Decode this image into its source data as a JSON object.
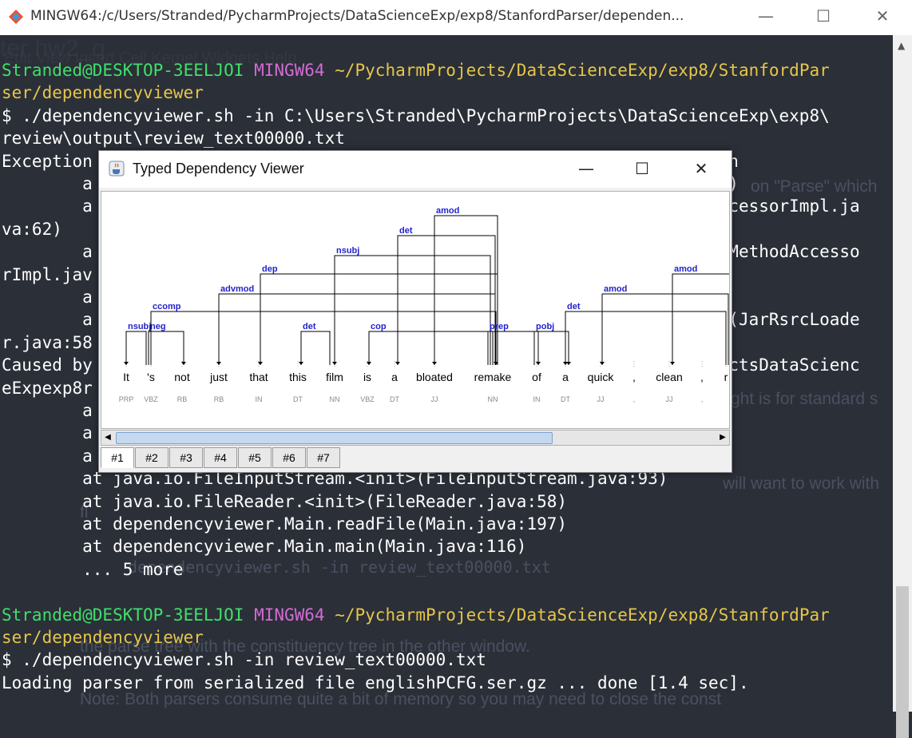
{
  "window": {
    "title": "MINGW64:/c/Users/Stranded/PycharmProjects/DataScienceExp/exp8/StanfordParser/dependen...",
    "minimize": "—",
    "maximize": "☐",
    "close": "✕"
  },
  "terminal": {
    "lines": [
      {
        "parts": [
          {
            "t": "Stranded@DESKTOP-3EELJOI ",
            "c": "g"
          },
          {
            "t": "MINGW64 ",
            "c": "m"
          },
          {
            "t": "~/PycharmProjects/DataScienceExp/exp8/StanfordPar",
            "c": "y"
          }
        ]
      },
      {
        "parts": [
          {
            "t": "ser/dependencyviewer",
            "c": "y"
          }
        ]
      },
      {
        "parts": [
          {
            "t": "$ ./dependencyviewer.sh -in C:\\Users\\Stranded\\PycharmProjects\\DataScienceExp\\exp8\\",
            "c": ""
          }
        ]
      },
      {
        "parts": [
          {
            "t": "review\\output\\review_text00000.txt",
            "c": ""
          }
        ]
      },
      {
        "parts": [
          {
            "t": "Exception                                                             ion",
            "c": ""
          }
        ]
      },
      {
        "parts": [
          {
            "t": "        a                                                             od)",
            "c": ""
          }
        ]
      },
      {
        "parts": [
          {
            "t": "        a                                                             AccessorImpl.ja",
            "c": ""
          }
        ]
      },
      {
        "parts": [
          {
            "t": "va:62)",
            "c": ""
          }
        ]
      },
      {
        "parts": [
          {
            "t": "        a                                                             ngMethodAccesso",
            "c": ""
          }
        ]
      },
      {
        "parts": [
          {
            "t": "rImpl.jav",
            "c": ""
          }
        ]
      },
      {
        "parts": [
          {
            "t": "        a",
            "c": ""
          }
        ]
      },
      {
        "parts": [
          {
            "t": "        a                                                             in(JarRsrcLoade",
            "c": ""
          }
        ]
      },
      {
        "parts": [
          {
            "t": "r.java:58",
            "c": ""
          }
        ]
      },
      {
        "parts": [
          {
            "t": "Caused by                                                             jectsDataScienc",
            "c": ""
          }
        ]
      },
      {
        "parts": [
          {
            "t": "eExpexp8r",
            "c": ""
          }
        ]
      },
      {
        "parts": [
          {
            "t": "        a",
            "c": ""
          }
        ]
      },
      {
        "parts": [
          {
            "t": "        a",
            "c": ""
          }
        ]
      },
      {
        "parts": [
          {
            "t": "        a",
            "c": ""
          }
        ]
      },
      {
        "parts": [
          {
            "t": "        at java.io.FileInputStream.<init>(FileInputStream.java:93)",
            "c": ""
          }
        ]
      },
      {
        "parts": [
          {
            "t": "        at java.io.FileReader.<init>(FileReader.java:58)",
            "c": ""
          }
        ]
      },
      {
        "parts": [
          {
            "t": "        at dependencyviewer.Main.readFile(Main.java:197)",
            "c": ""
          }
        ]
      },
      {
        "parts": [
          {
            "t": "        at dependencyviewer.Main.main(Main.java:116)",
            "c": ""
          }
        ]
      },
      {
        "parts": [
          {
            "t": "        ... 5 more",
            "c": ""
          }
        ]
      },
      {
        "parts": [
          {
            "t": "",
            "c": ""
          }
        ]
      },
      {
        "parts": [
          {
            "t": "Stranded@DESKTOP-3EELJOI ",
            "c": "g"
          },
          {
            "t": "MINGW64 ",
            "c": "m"
          },
          {
            "t": "~/PycharmProjects/DataScienceExp/exp8/StanfordPar",
            "c": "y"
          }
        ]
      },
      {
        "parts": [
          {
            "t": "ser/dependencyviewer",
            "c": "y"
          }
        ]
      },
      {
        "parts": [
          {
            "t": "$ ./dependencyviewer.sh -in review_text00000.txt",
            "c": ""
          }
        ]
      },
      {
        "parts": [
          {
            "t": "Loading parser from serialized file englishPCFG.ser.gz ... done [1.4 sec].",
            "c": ""
          }
        ]
      }
    ]
  },
  "background_ghost": {
    "items": [
      "Edit    View    Insert    Cell    Kernel    Widgets    Help",
      "on \"Parse\" which",
      "ght is for standard s",
      "will want to work with",
      "fi",
      "dependencyviewer.sh -in review_text00000.txt",
      "the parse tree with the constituency tree in the other window.",
      "Note: Both parsers consume quite a bit of memory so you may need to close the const",
      "ter  hw2_q"
    ]
  },
  "viewer": {
    "title": "Typed Dependency Viewer",
    "minimize": "—",
    "maximize": "☐",
    "close": "✕",
    "tabs": [
      "#1",
      "#2",
      "#3",
      "#4",
      "#5",
      "#6",
      "#7"
    ],
    "selected_tab": "#1",
    "words": [
      {
        "w": "It",
        "pos": "PRP"
      },
      {
        "w": "'s",
        "pos": "VBZ"
      },
      {
        "w": "not",
        "pos": "RB"
      },
      {
        "w": "just",
        "pos": "RB"
      },
      {
        "w": "that",
        "pos": "IN"
      },
      {
        "w": "this",
        "pos": "DT"
      },
      {
        "w": "film",
        "pos": "NN"
      },
      {
        "w": "is",
        "pos": "VBZ"
      },
      {
        "w": "a",
        "pos": "DT"
      },
      {
        "w": "bloated",
        "pos": "JJ"
      },
      {
        "w": "remake",
        "pos": "NN"
      },
      {
        "w": "of",
        "pos": "IN"
      },
      {
        "w": "a",
        "pos": "DT"
      },
      {
        "w": "quick",
        "pos": "JJ"
      },
      {
        "w": ",",
        "pos": ","
      },
      {
        "w": "clean",
        "pos": "JJ"
      },
      {
        "w": ",",
        "pos": ","
      },
      {
        "w": "r",
        "pos": ""
      }
    ],
    "arcs": [
      {
        "label": "nsubj",
        "from": 1,
        "to": 0
      },
      {
        "label": "neg",
        "from": 1,
        "to": 2
      },
      {
        "label": "ccomp",
        "from": 1,
        "to": 10
      },
      {
        "label": "advmod",
        "from": 10,
        "to": 3
      },
      {
        "label": "dep",
        "from": 10,
        "to": 4
      },
      {
        "label": "det",
        "from": 6,
        "to": 5
      },
      {
        "label": "nsubj",
        "from": 10,
        "to": 6
      },
      {
        "label": "cop",
        "from": 10,
        "to": 7
      },
      {
        "label": "det",
        "from": 10,
        "to": 8
      },
      {
        "label": "amod",
        "from": 10,
        "to": 9
      },
      {
        "label": "prep",
        "from": 10,
        "to": 11
      },
      {
        "label": "pobj",
        "from": 11,
        "to": 12
      },
      {
        "label": "det",
        "from": 17,
        "to": 12
      },
      {
        "label": "amod",
        "from": 17,
        "to": 13
      },
      {
        "label": "amod",
        "from": 17,
        "to": 15
      }
    ]
  },
  "colors": {
    "prompt_user": "#3fe06a",
    "prompt_host": "#d36bd3",
    "prompt_path": "#e5c64a",
    "terminal_bg": "#2b2f38",
    "arc_label": "#2222cc"
  }
}
